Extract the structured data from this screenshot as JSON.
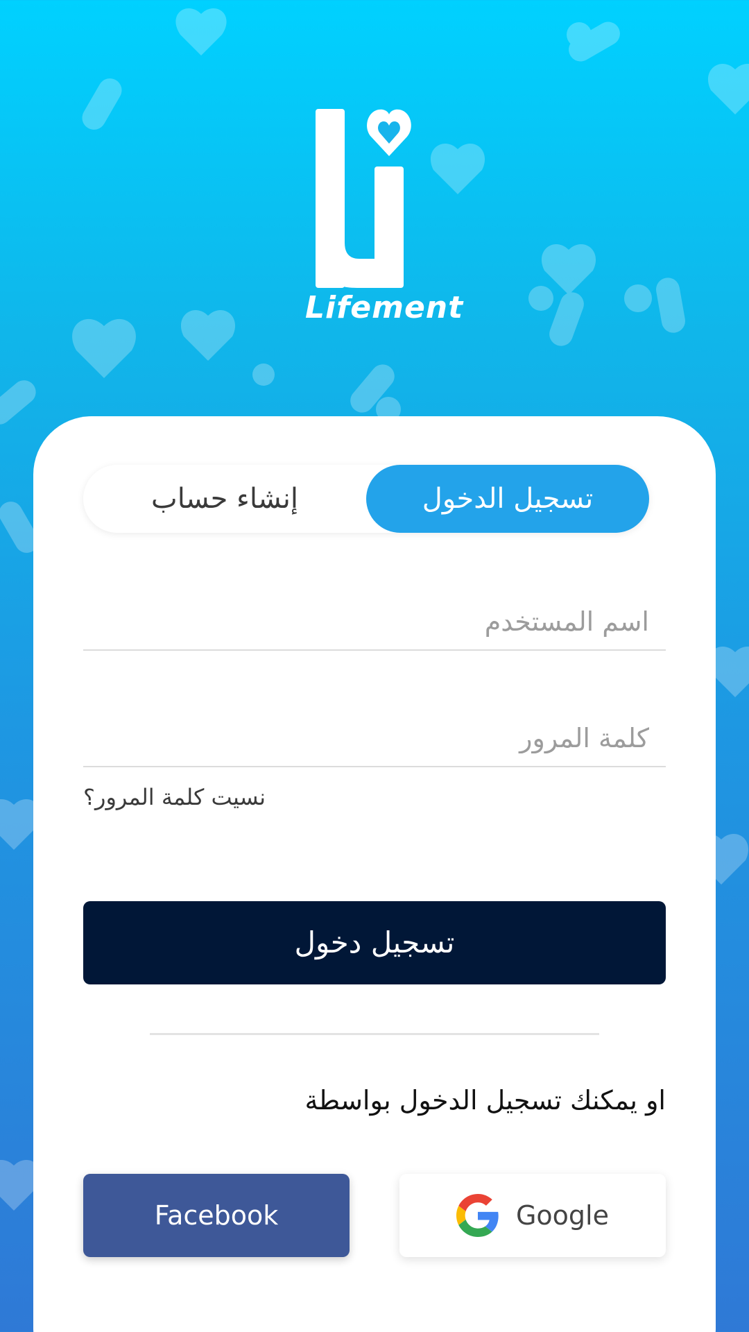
{
  "app": {
    "logo_text": "Lifement"
  },
  "tabs": {
    "login_label": "تسجيل الدخول",
    "register_label": "إنشاء حساب",
    "active": "login"
  },
  "form": {
    "username_placeholder": "اسم المستخدم",
    "username_value": "",
    "password_placeholder": "كلمة المرور",
    "password_value": "",
    "forgot_label": "نسيت كلمة المرور؟",
    "submit_label": "تسجيل دخول"
  },
  "social": {
    "intro_text": "او يمكنك تسجيل الدخول بواسطة",
    "facebook_label": "Facebook",
    "google_label": "Google"
  },
  "colors": {
    "primary_blue": "#23a3ea",
    "submit_navy": "#011737",
    "facebook_blue": "#3e5898"
  },
  "icons": {
    "logo": "lifement-logo-icon",
    "google": "google-icon"
  }
}
